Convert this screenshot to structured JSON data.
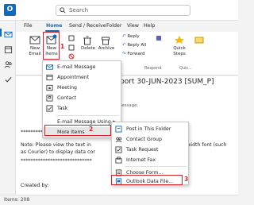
{
  "title_bar": {
    "search_placeholder": "Search"
  },
  "ribbon_tabs": [
    "File",
    "Home",
    "Send / Receive",
    "Folder",
    "View",
    "Help"
  ],
  "ribbon": {
    "new_email": [
      "New",
      "Email"
    ],
    "new_items": [
      "New",
      "Items"
    ],
    "delete": "Delete",
    "archive": "Archive",
    "reply": "Reply",
    "reply_all": "Reply All",
    "forward": "Forward",
    "respond_group": "Respond",
    "quick_steps": [
      "Quick",
      "Steps"
    ],
    "quick_group": "Quic...",
    "colors": {
      "accent": "#0f6cbd",
      "highlight": "#d71f2a"
    }
  },
  "new_items_menu": {
    "items": [
      "E-mail Message",
      "Appointment",
      "Meeting",
      "Contact",
      "Task",
      "E-mail Message Using",
      "More Items"
    ]
  },
  "more_items_submenu": {
    "items": [
      "Post in This Folder",
      "Contact Group",
      "Task Request",
      "Internet Fax",
      "Choose Form...",
      "Outlook Data File..."
    ]
  },
  "annotations": {
    "step1": "1",
    "step2": "2",
    "step3": "3"
  },
  "message": {
    "subject": "ent Report 30-JUN-2023 [SUM_P]",
    "line_info": "this message.",
    "asterisks1": "************************",
    "note_line1": "Note: Please view the text in",
    "note_line1_end": "fixed-width font (such",
    "note_line2": "as Courier) to display data cor",
    "asterisks2": "*****************************",
    "created_by": "Created by:"
  },
  "status_bar": {
    "items": "Items: 208"
  }
}
